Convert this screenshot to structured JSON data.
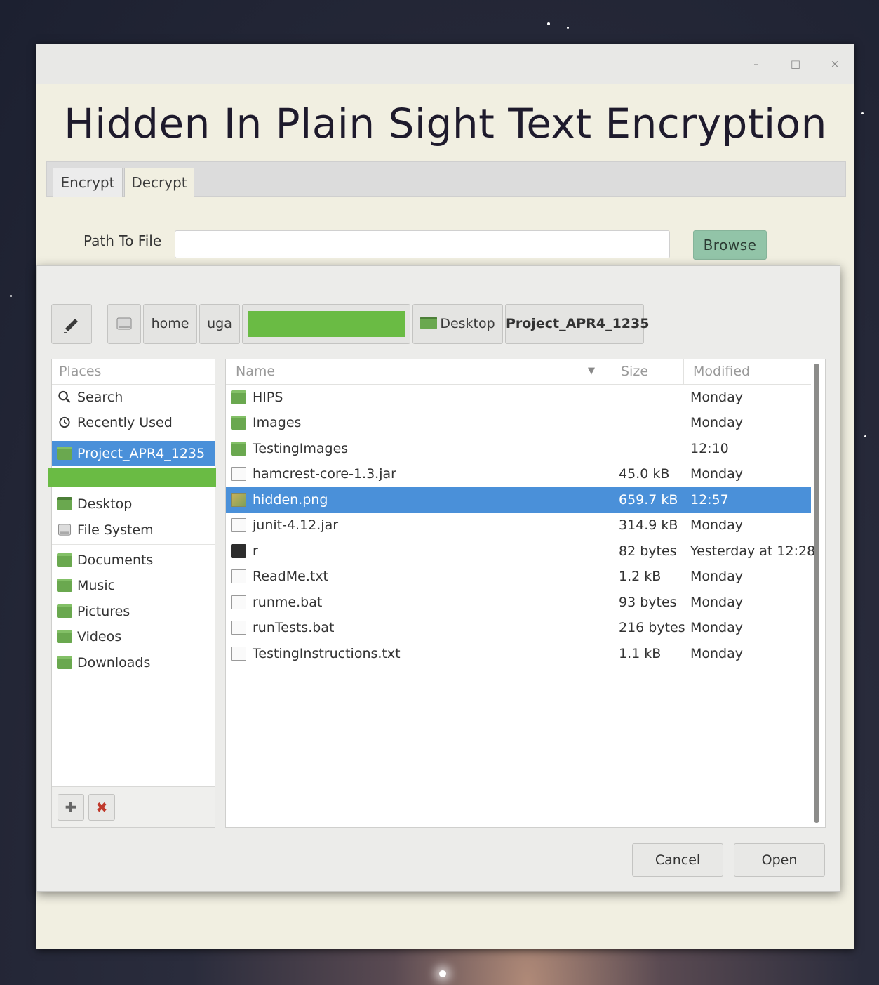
{
  "app": {
    "title": "Hidden In Plain Sight Text Encryption",
    "window_controls": {
      "minimize": "–",
      "maximize": "□",
      "close": "×"
    },
    "tabs": [
      {
        "label": "Encrypt"
      },
      {
        "label": "Decrypt"
      }
    ],
    "path_label": "Path To File",
    "path_value": "",
    "browse_label": "Browse"
  },
  "file_dialog": {
    "path_bar": {
      "edit_icon": "pencil-icon",
      "drive_icon": "drive-icon",
      "segments": [
        "home",
        "uga",
        "Desktop",
        "Project_APR4_1235"
      ]
    },
    "places": {
      "header": "Places",
      "items": [
        {
          "label": "Search",
          "icon": "search-icon"
        },
        {
          "label": "Recently Used",
          "icon": "recent-icon"
        },
        {
          "label": "Project_APR4_1235",
          "icon": "folder-icon",
          "selected": true
        },
        {
          "label": "Desktop",
          "icon": "desktop-icon"
        },
        {
          "label": "File System",
          "icon": "drive-icon"
        },
        {
          "label": "Documents",
          "icon": "documents-folder-icon"
        },
        {
          "label": "Music",
          "icon": "music-folder-icon"
        },
        {
          "label": "Pictures",
          "icon": "pictures-folder-icon"
        },
        {
          "label": "Videos",
          "icon": "videos-folder-icon"
        },
        {
          "label": "Downloads",
          "icon": "downloads-folder-icon"
        }
      ],
      "add_label": "✚",
      "remove_label": "✖"
    },
    "files": {
      "columns": {
        "name": "Name",
        "size": "Size",
        "modified": "Modified"
      },
      "sort_indicator": "▼",
      "rows": [
        {
          "name": "HIPS",
          "size": "",
          "modified": "Monday",
          "icon": "folder-icon"
        },
        {
          "name": "Images",
          "size": "",
          "modified": "Monday",
          "icon": "folder-icon"
        },
        {
          "name": "TestingImages",
          "size": "",
          "modified": "12:10",
          "icon": "folder-icon"
        },
        {
          "name": "hamcrest-core-1.3.jar",
          "size": "45.0 kB",
          "modified": "Monday",
          "icon": "jar-icon"
        },
        {
          "name": "hidden.png",
          "size": "659.7 kB",
          "modified": "12:57",
          "icon": "image-icon",
          "selected": true
        },
        {
          "name": "junit-4.12.jar",
          "size": "314.9 kB",
          "modified": "Monday",
          "icon": "jar-icon"
        },
        {
          "name": "r",
          "size": "82 bytes",
          "modified": "Yesterday at 12:28",
          "icon": "terminal-icon"
        },
        {
          "name": "ReadMe.txt",
          "size": "1.2 kB",
          "modified": "Monday",
          "icon": "text-file-icon"
        },
        {
          "name": "runme.bat",
          "size": "93 bytes",
          "modified": "Monday",
          "icon": "text-file-icon"
        },
        {
          "name": "runTests.bat",
          "size": "216 bytes",
          "modified": "Monday",
          "icon": "binary-file-icon"
        },
        {
          "name": "TestingInstructions.txt",
          "size": "1.1 kB",
          "modified": "Monday",
          "icon": "text-file-icon"
        }
      ]
    },
    "cancel_label": "Cancel",
    "open_label": "Open"
  },
  "colors": {
    "selection": "#4a90d9",
    "folder": "#6aa84f",
    "browse_button": "#92c4a8",
    "redaction": "#6abb44",
    "window_bg": "#f1efe1"
  }
}
